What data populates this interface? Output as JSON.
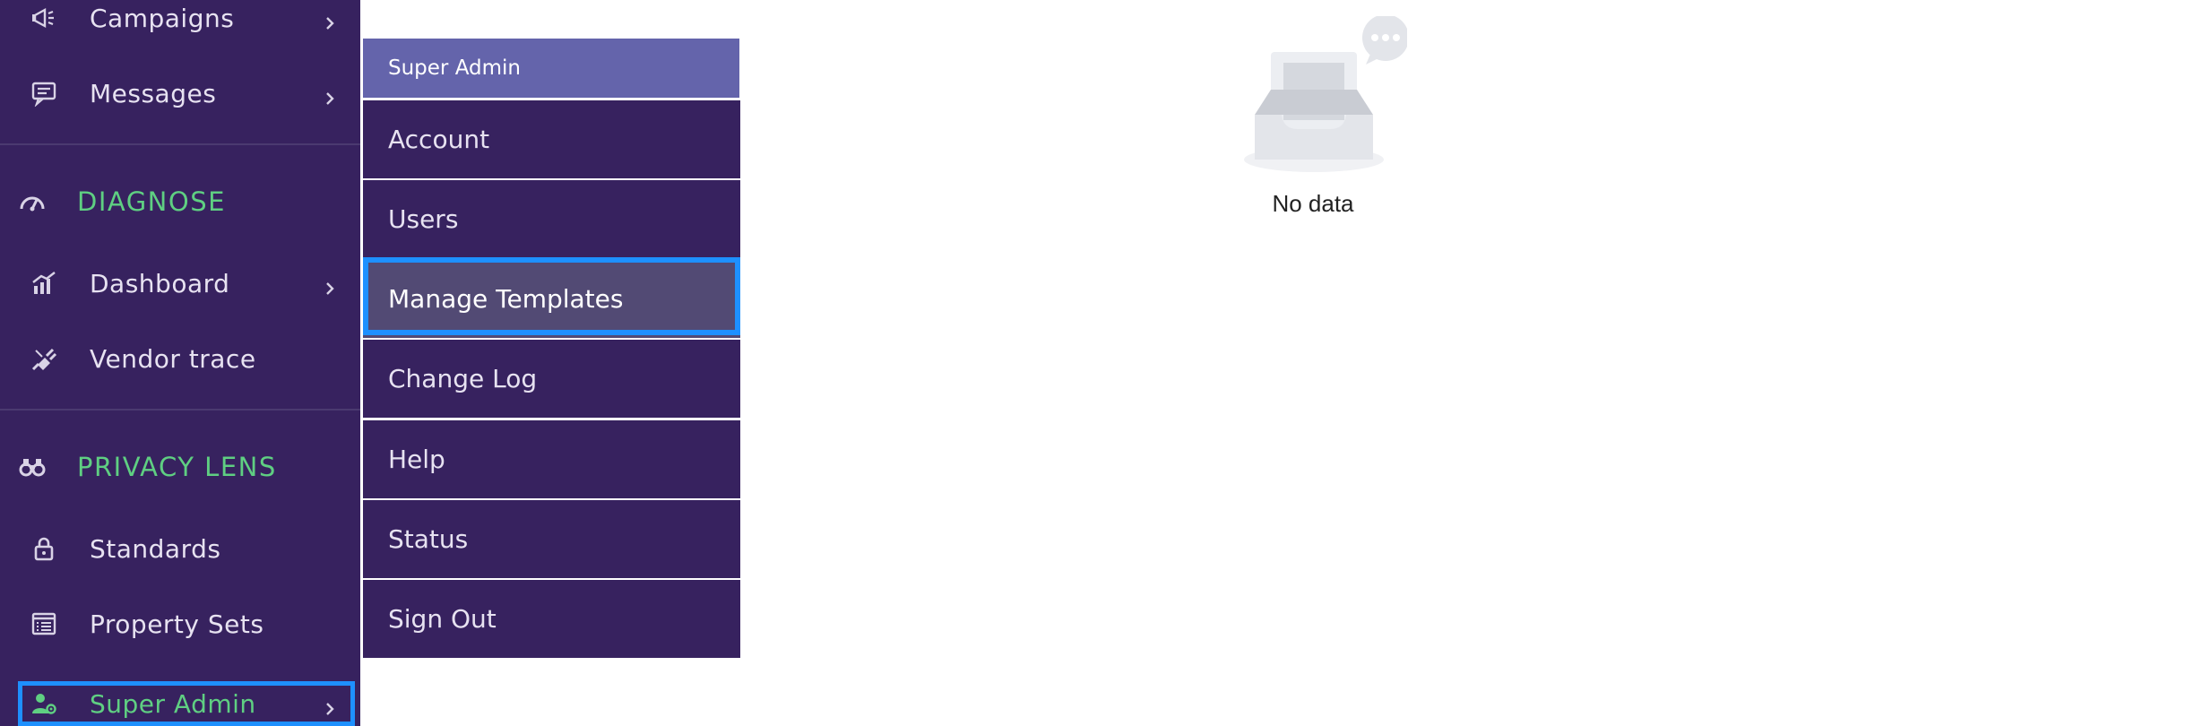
{
  "sidebar": {
    "items": [
      {
        "label": "Campaigns",
        "icon": "megaphone-icon"
      },
      {
        "label": "Messages",
        "icon": "message-icon"
      },
      {
        "label": "Dashboard",
        "icon": "chart-icon"
      },
      {
        "label": "Vendor trace",
        "icon": "plug-icon"
      },
      {
        "label": "Standards",
        "icon": "lock-icon"
      },
      {
        "label": "Property Sets",
        "icon": "list-icon"
      },
      {
        "label": "Super Admin",
        "icon": "user-gear-icon"
      }
    ],
    "sections": [
      {
        "label": "DIAGNOSE",
        "icon": "gauge-icon"
      },
      {
        "label": "PRIVACY LENS",
        "icon": "binoculars-icon"
      }
    ]
  },
  "submenu": {
    "header": "Super Admin",
    "items": [
      "Account",
      "Users",
      "Manage Templates",
      "Change Log",
      "Help",
      "Status",
      "Sign Out"
    ],
    "selected": "Manage Templates"
  },
  "content": {
    "empty_text": "No data"
  },
  "colors": {
    "sidebar_bg": "#37225f",
    "section_green": "#5fcf82",
    "submenu_header": "#6464ab",
    "focus_blue": "#1e90ff"
  }
}
